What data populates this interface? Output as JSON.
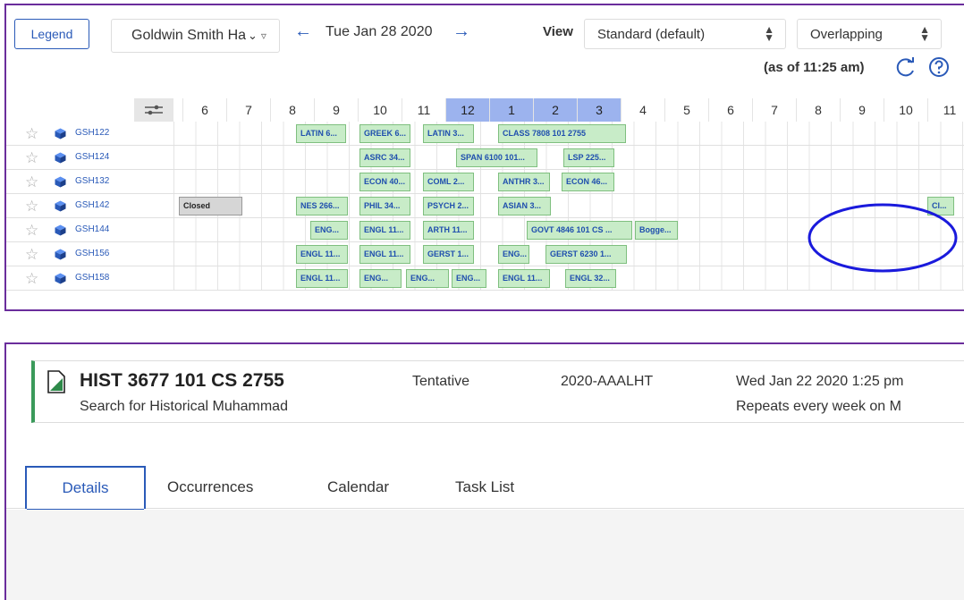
{
  "toolbar": {
    "legend_label": "Legend",
    "location_value": "Goldwin Smith Ha",
    "date_label": "Tue Jan 28 2020",
    "view_label": "View",
    "view_value": "Standard (default)",
    "overlap_value": "Overlapping",
    "as_of_label": "(as of 11:25 am)"
  },
  "grid": {
    "hours": [
      "6",
      "7",
      "8",
      "9",
      "10",
      "11",
      "12",
      "1",
      "2",
      "3",
      "4",
      "5",
      "6",
      "7",
      "8",
      "9",
      "10",
      "11"
    ],
    "highlighted_hours": [
      "12",
      "1",
      "2",
      "3"
    ],
    "rows": [
      {
        "room": "GSH122",
        "events": [
          "LATIN 6...",
          "GREEK 6...",
          "LATIN 3...",
          "CLASS 7808 101 2755"
        ]
      },
      {
        "room": "GSH124",
        "events": [
          "ASRC 34...",
          "SPAN 6100 101...",
          "LSP 225..."
        ]
      },
      {
        "room": "GSH132",
        "events": [
          "ECON 40...",
          "COML 2...",
          "ANTHR 3...",
          "ECON 46..."
        ]
      },
      {
        "room": "GSH142",
        "events": [
          "Closed",
          "NES 266...",
          "PHIL 34...",
          "PSYCH 2...",
          "ASIAN 3...",
          "Cl..."
        ]
      },
      {
        "room": "GSH144",
        "events": [
          "ENG...",
          "ENGL 11...",
          "ARTH 11...",
          "GOVT 4846 101 CS ...",
          "Bogge..."
        ]
      },
      {
        "room": "GSH156",
        "events": [
          "ENGL 11...",
          "ENGL 11...",
          "GERST 1...",
          "ENG...",
          "GERST 6230 1..."
        ]
      },
      {
        "room": "GSH158",
        "events": [
          "ENGL 11...",
          "ENG...",
          "ENG...",
          "ENG...",
          "ENGL 11...",
          "ENGL 32..."
        ]
      }
    ]
  },
  "event": {
    "title": "HIST 3677 101 CS 2755",
    "subtitle": "Search for Historical Muhammad",
    "state": "Tentative",
    "reference": "2020-AAALHT",
    "date_time": "Wed Jan 22 2020 1:25 pm",
    "repeat": "Repeats every week on M"
  },
  "tabs": [
    {
      "label": "Details",
      "active": true
    },
    {
      "label": "Occurrences",
      "active": false
    },
    {
      "label": "Calendar",
      "active": false
    },
    {
      "label": "Task List",
      "active": false
    }
  ],
  "colors": {
    "accent": "#2a5ab8",
    "panel_border": "#6a2d9c",
    "event_fill": "#c8ecc8",
    "hour_highlight": "#9cb3ee",
    "annotation": "#1a1adc"
  }
}
